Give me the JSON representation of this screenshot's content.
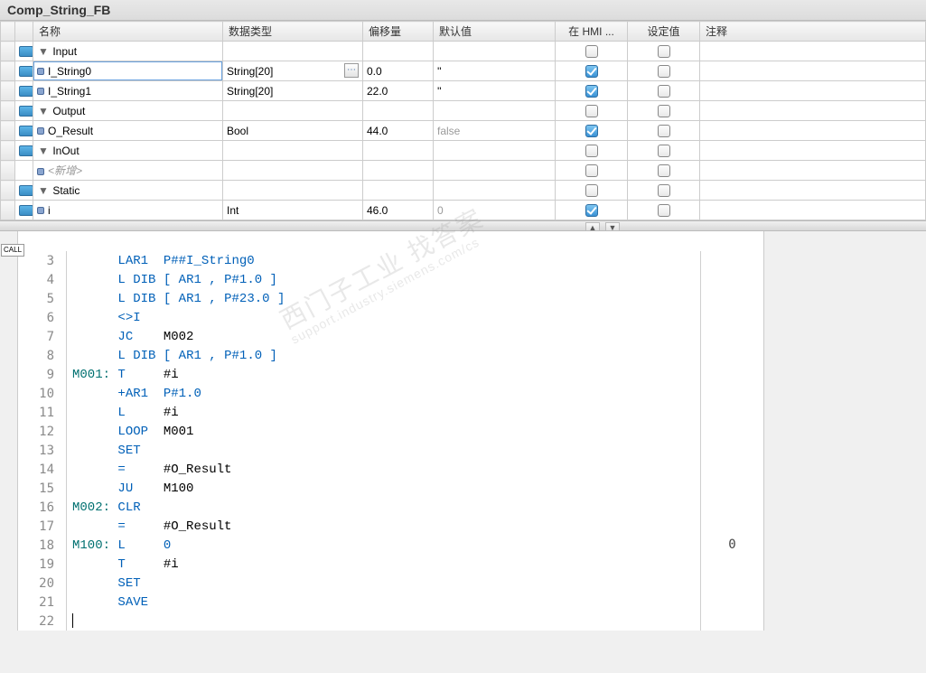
{
  "title": "Comp_String_FB",
  "columns": {
    "name": "名称",
    "datatype": "数据类型",
    "offset": "偏移量",
    "default": "默认值",
    "hmi": "在 HMI ...",
    "setval": "设定值",
    "comment": "注释"
  },
  "rows": [
    {
      "kind": "section",
      "exp": "▼",
      "name": "Input",
      "type": "",
      "offset": "",
      "default": "",
      "hmi": null,
      "setval": null,
      "tag": true
    },
    {
      "kind": "var",
      "indent": 2,
      "name": "I_String0",
      "type": "String[20]",
      "offset": "0.0",
      "default": "''",
      "hmi": true,
      "setval": false,
      "detail": true,
      "tag": true,
      "editing": true
    },
    {
      "kind": "var",
      "indent": 2,
      "name": "I_String1",
      "type": "String[20]",
      "offset": "22.0",
      "default": "''",
      "hmi": true,
      "setval": false,
      "tag": true
    },
    {
      "kind": "section",
      "exp": "▼",
      "name": "Output",
      "type": "",
      "offset": "",
      "default": "",
      "hmi": null,
      "setval": null,
      "tag": true
    },
    {
      "kind": "var",
      "indent": 2,
      "name": "O_Result",
      "type": "Bool",
      "offset": "44.0",
      "default": "false",
      "default_faded": true,
      "hmi": true,
      "setval": false,
      "tag": true
    },
    {
      "kind": "section",
      "exp": "▼",
      "name": "InOut",
      "type": "",
      "offset": "",
      "default": "",
      "hmi": null,
      "setval": null,
      "tag": true
    },
    {
      "kind": "placeholder",
      "indent": 2,
      "name": "<新增>",
      "type": "",
      "offset": "",
      "default": "",
      "hmi": null,
      "setval": null,
      "tag": false
    },
    {
      "kind": "section",
      "exp": "▼",
      "name": "Static",
      "type": "",
      "offset": "",
      "default": "",
      "hmi": null,
      "setval": null,
      "tag": true
    },
    {
      "kind": "var",
      "indent": 2,
      "name": "i",
      "type": "Int",
      "offset": "46.0",
      "default": "0",
      "default_faded": true,
      "hmi": true,
      "setval": false,
      "tag": true
    }
  ],
  "code": [
    {
      "n": 3,
      "text": "      LAR1  P##I_String0",
      "cls": [
        "",
        "kw-blue",
        "operand-blue"
      ]
    },
    {
      "n": 4,
      "text": "      L DIB [ AR1 , P#1.0 ]"
    },
    {
      "n": 5,
      "text": "      L DIB [ AR1 , P#23.0 ]"
    },
    {
      "n": 6,
      "text": "      <>I"
    },
    {
      "n": 7,
      "text": "      JC    M002"
    },
    {
      "n": 8,
      "text": "      L DIB [ AR1 , P#1.0 ]"
    },
    {
      "n": 9,
      "label": "M001:",
      "text": " T     #i"
    },
    {
      "n": 10,
      "text": "      +AR1  P#1.0"
    },
    {
      "n": 11,
      "text": "      L     #i"
    },
    {
      "n": 12,
      "text": "      LOOP  M001"
    },
    {
      "n": 13,
      "text": "      SET"
    },
    {
      "n": 14,
      "text": "      =     #O_Result"
    },
    {
      "n": 15,
      "text": "      JU    M100"
    },
    {
      "n": 16,
      "label": "M002:",
      "text": " CLR"
    },
    {
      "n": 17,
      "text": "      =     #O_Result"
    },
    {
      "n": 18,
      "label": "M100:",
      "text": " L     0",
      "meta": "0"
    },
    {
      "n": 19,
      "text": "      T     #i"
    },
    {
      "n": 20,
      "text": "      SET"
    },
    {
      "n": 21,
      "text": "      SAVE"
    },
    {
      "n": 22,
      "text": "|",
      "cursor": true
    }
  ],
  "call_marker": "CALL",
  "watermark": {
    "line1": "西门子工业 找答案",
    "line2": "support.industry.siemens.com/cs"
  }
}
